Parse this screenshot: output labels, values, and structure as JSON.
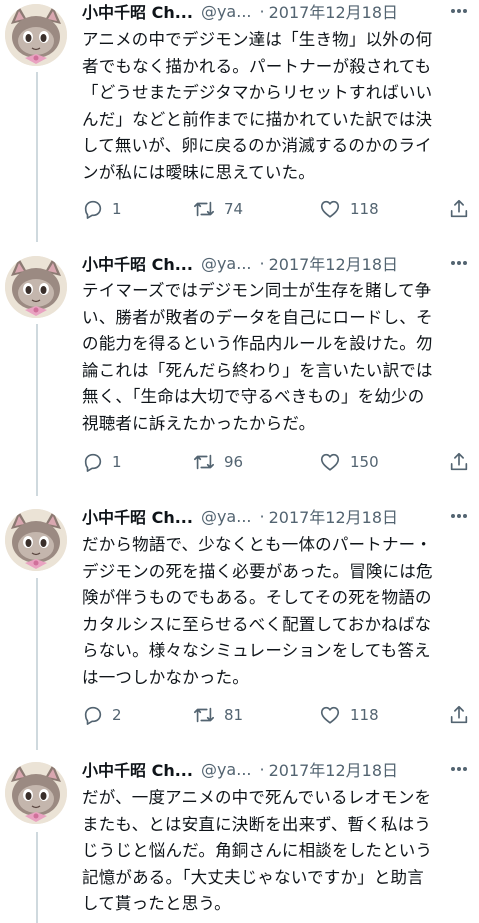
{
  "author": {
    "name": "小中千昭 Ch...",
    "handle": "@ya...",
    "separator": "·"
  },
  "colors": {
    "text": "#0f1419",
    "muted": "#536471",
    "thread_line": "#cfd9de"
  },
  "icons": {
    "more": "more-dots-icon",
    "reply": "reply-icon",
    "retweet": "retweet-icon",
    "like": "heart-icon",
    "share": "share-icon"
  },
  "tweets": [
    {
      "date": "2017年12月18日",
      "text": "アニメの中でデジモン達は「生き物」以外の何\n者でもなく描かれる。パートナーが殺されても\n「どうせまたデジタマからリセットすればいい\nんだ」などと前作までに描かれていた訳では決\nして無いが、卵に戻るのか消滅するのかのライ\nンが私には曖昧に思えていた。",
      "replies": "1",
      "retweets": "74",
      "likes": "118"
    },
    {
      "date": "2017年12月18日",
      "text": "テイマーズではデジモン同士が生存を賭して争\nい、勝者が敗者のデータを自己にロードし、そ\nの能力を得るという作品内ルールを設けた。勿\n論これは「死んだら終わり」を言いたい訳では\n無く、「生命は大切で守るべきもの」を幼少の\n視聴者に訴えたかったからだ。",
      "replies": "1",
      "retweets": "96",
      "likes": "150"
    },
    {
      "date": "2017年12月18日",
      "text": "だから物語で、少なくとも一体のパートナー・\nデジモンの死を描く必要があった。冒険には危\n険が伴うものでもある。そしてその死を物語の\nカタルシスに至らせるべく配置しておかねばな\nらない。様々なシミュレーションをしても答え\nは一つしかなかった。",
      "replies": "2",
      "retweets": "81",
      "likes": "118"
    },
    {
      "date": "2017年12月18日",
      "text": "だが、一度アニメの中で死んでいるレオモンを\nまたも、とは安直に決断を出来ず、暫く私はう\nじうじと悩んだ。角銅さんに相談をしたという\n記憶がある。「大丈夫じゃないですか」と助言\nして貰ったと思う。"
    }
  ]
}
